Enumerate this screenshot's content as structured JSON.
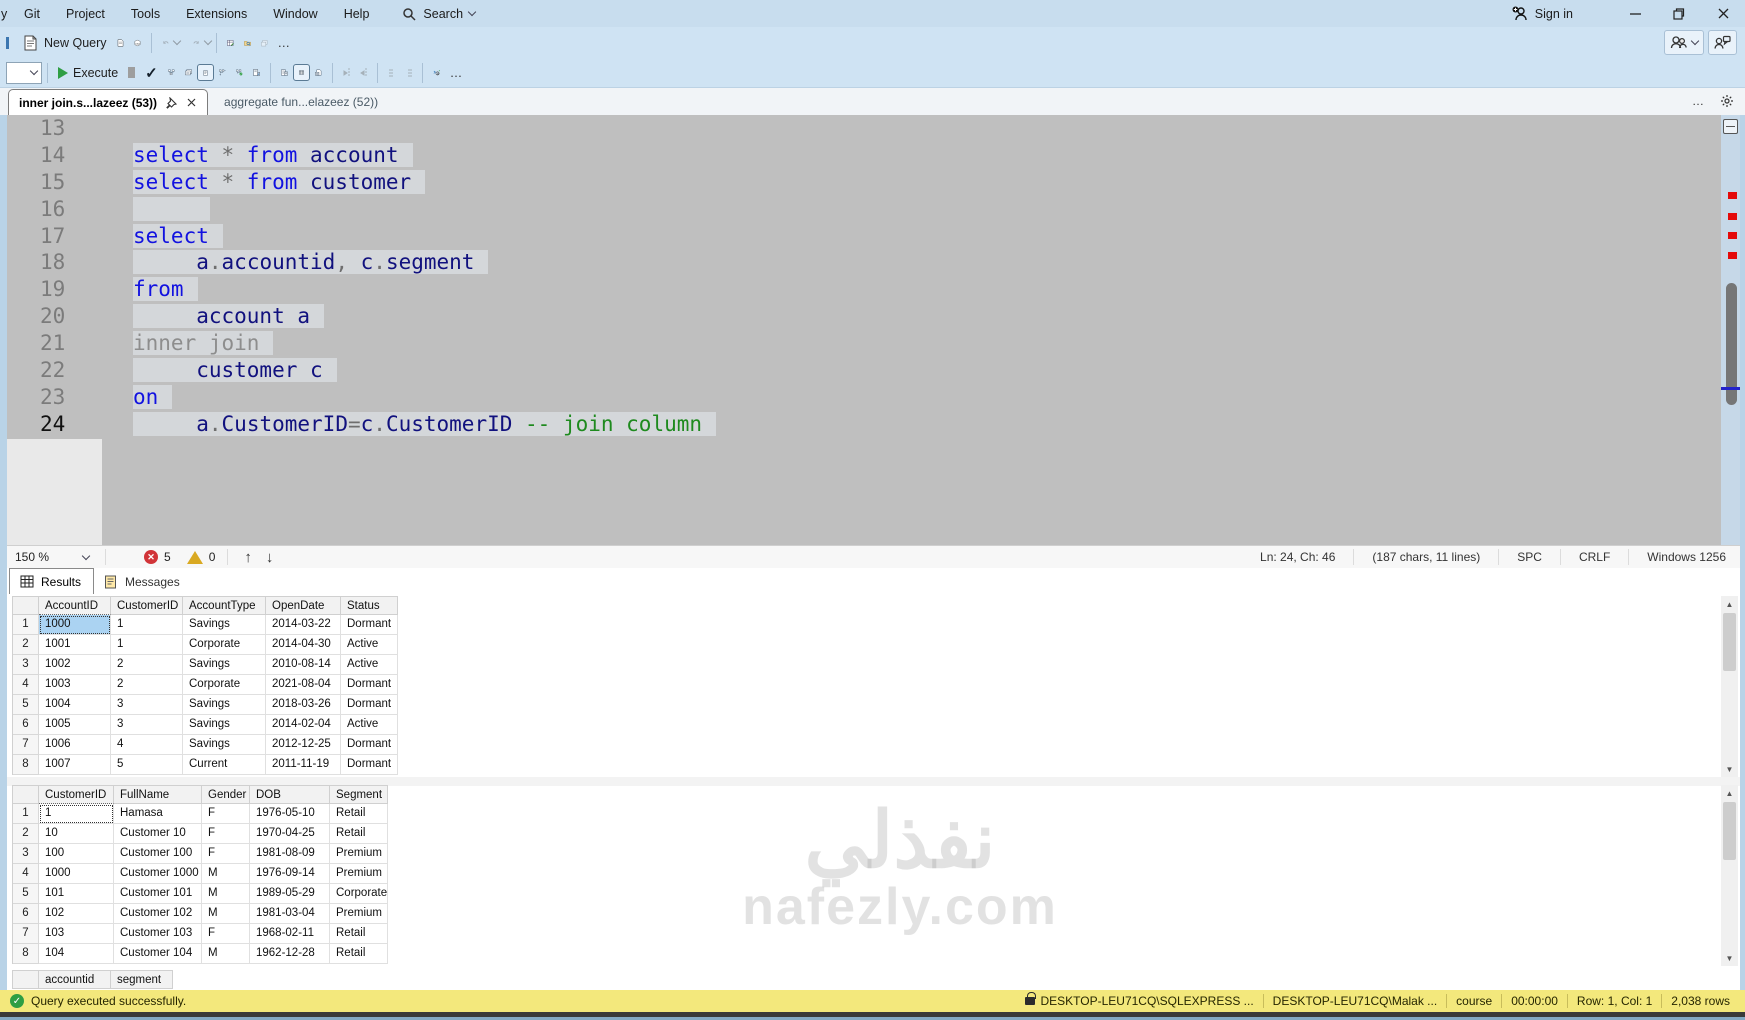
{
  "menu": {
    "partial": "y",
    "items": [
      "Git",
      "Project",
      "Tools",
      "Extensions",
      "Window",
      "Help"
    ],
    "search": "Search"
  },
  "window_controls": {
    "signin": "Sign in"
  },
  "toolbar": {
    "new_query": "New Query",
    "execute": "Execute",
    "overflow": "…"
  },
  "tabs": {
    "active": "inner join.s...lazeez (53))",
    "inactive": "aggregate fun...elazeez (52))"
  },
  "editor": {
    "lines": [
      {
        "n": "13",
        "t": []
      },
      {
        "n": "14",
        "t": [
          [
            "k",
            "select"
          ],
          [
            "o",
            " * "
          ],
          [
            "k",
            "from"
          ],
          [
            "i",
            " account"
          ]
        ]
      },
      {
        "n": "15",
        "t": [
          [
            "k",
            "select"
          ],
          [
            "o",
            " * "
          ],
          [
            "k",
            "from"
          ],
          [
            "i",
            " customer"
          ]
        ]
      },
      {
        "n": "16",
        "t": [
          [
            "w",
            "     "
          ]
        ]
      },
      {
        "n": "17",
        "t": [
          [
            "k",
            "select"
          ]
        ]
      },
      {
        "n": "18",
        "t": [
          [
            "w",
            "     "
          ],
          [
            "i",
            "a"
          ],
          [
            "o",
            "."
          ],
          [
            "i",
            "accountid"
          ],
          [
            "o",
            ", "
          ],
          [
            "i",
            "c"
          ],
          [
            "o",
            "."
          ],
          [
            "i",
            "segment"
          ]
        ]
      },
      {
        "n": "19",
        "t": [
          [
            "k",
            "from"
          ]
        ]
      },
      {
        "n": "20",
        "t": [
          [
            "w",
            "     "
          ],
          [
            "i",
            "account a"
          ]
        ]
      },
      {
        "n": "21",
        "t": [
          [
            "g",
            "inner join"
          ]
        ]
      },
      {
        "n": "22",
        "t": [
          [
            "w",
            "     "
          ],
          [
            "i",
            "customer c"
          ]
        ]
      },
      {
        "n": "23",
        "t": [
          [
            "k",
            "on"
          ]
        ]
      },
      {
        "n": "24",
        "cur": true,
        "t": [
          [
            "w",
            "     "
          ],
          [
            "i",
            "a"
          ],
          [
            "o",
            "."
          ],
          [
            "i",
            "CustomerID"
          ],
          [
            "o",
            "="
          ],
          [
            "i",
            "c"
          ],
          [
            "o",
            "."
          ],
          [
            "i",
            "CustomerID"
          ],
          [
            "c",
            " -- join column"
          ]
        ]
      }
    ]
  },
  "zoombar": {
    "zoom": "150 %",
    "errors": "5",
    "warnings": "0"
  },
  "position": {
    "ln": "Ln: 24, Ch: 46",
    "chars": "(187 chars, 11 lines)",
    "spc": "SPC",
    "eol": "CRLF",
    "encoding": "Windows 1256"
  },
  "results": {
    "tabs": [
      "Results",
      "Messages"
    ],
    "grid1": {
      "headers": [
        "AccountID",
        "CustomerID",
        "AccountType",
        "OpenDate",
        "Status"
      ],
      "rows": [
        [
          "1000",
          "1",
          "Savings",
          "2014-03-22",
          "Dormant"
        ],
        [
          "1001",
          "1",
          "Corporate",
          "2014-04-30",
          "Active"
        ],
        [
          "1002",
          "2",
          "Savings",
          "2010-08-14",
          "Active"
        ],
        [
          "1003",
          "2",
          "Corporate",
          "2021-08-04",
          "Dormant"
        ],
        [
          "1004",
          "3",
          "Savings",
          "2018-03-26",
          "Dormant"
        ],
        [
          "1005",
          "3",
          "Savings",
          "2014-02-04",
          "Active"
        ],
        [
          "1006",
          "4",
          "Savings",
          "2012-12-25",
          "Dormant"
        ],
        [
          "1007",
          "5",
          "Current",
          "2011-11-19",
          "Dormant"
        ]
      ],
      "selected": {
        "r": 0,
        "c": 0,
        "style": "blue"
      }
    },
    "grid2": {
      "headers": [
        "CustomerID",
        "FullName",
        "Gender",
        "DOB",
        "Segment"
      ],
      "rows": [
        [
          "1",
          "Hamasa",
          "F",
          "1976-05-10",
          "Retail"
        ],
        [
          "10",
          "Customer 10",
          "F",
          "1970-04-25",
          "Retail"
        ],
        [
          "100",
          "Customer 100",
          "F",
          "1981-08-09",
          "Premium"
        ],
        [
          "1000",
          "Customer 1000",
          "M",
          "1976-09-14",
          "Premium"
        ],
        [
          "101",
          "Customer 101",
          "M",
          "1989-05-29",
          "Corporate"
        ],
        [
          "102",
          "Customer 102",
          "M",
          "1981-03-04",
          "Premium"
        ],
        [
          "103",
          "Customer 103",
          "F",
          "1968-02-11",
          "Retail"
        ],
        [
          "104",
          "Customer 104",
          "M",
          "1962-12-28",
          "Retail"
        ]
      ],
      "selected": {
        "r": 0,
        "c": 0,
        "style": "focus"
      }
    },
    "grid3": {
      "headers": [
        "accountid",
        "segment"
      ],
      "rows": []
    }
  },
  "statusbar": {
    "message": "Query executed successfully.",
    "server": "DESKTOP-LEU71CQ\\SQLEXPRESS ...",
    "user": "DESKTOP-LEU71CQ\\Malak ...",
    "database": "course",
    "time": "00:00:00",
    "pos": "Row: 1, Col: 1",
    "rowcount": "2,038 rows"
  },
  "watermark": {
    "line1": "نفذلي",
    "line2": "nafezly.com"
  },
  "colors": {
    "keyword": "#1212e0",
    "identifier": "#11117e",
    "comment": "#1e8a1e",
    "gray_keyword": "#8d8d8d",
    "editor_selection": "#bfbfbf",
    "cell_selected": "#abd3f2",
    "status_yellow": "#f3e87c",
    "exec_green": "#2f9e44",
    "error_red": "#d13438",
    "titlebar_blue": "#c8ddee"
  }
}
